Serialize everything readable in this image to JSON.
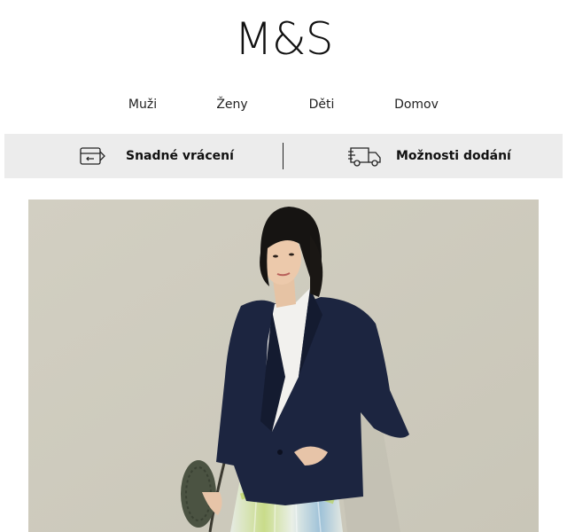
{
  "brand": {
    "logo_text": "M&S"
  },
  "nav": {
    "items": [
      {
        "label": "Muži"
      },
      {
        "label": "Ženy"
      },
      {
        "label": "Děti"
      },
      {
        "label": "Domov"
      }
    ]
  },
  "services": {
    "returns": {
      "label": "Snadné vrácení",
      "icon": "return-tag-icon"
    },
    "delivery": {
      "label": "Možnosti dodání",
      "icon": "delivery-truck-icon"
    }
  },
  "hero": {
    "image": "woman-in-navy-blazer-photo",
    "background_color": "#d4d0c4"
  }
}
